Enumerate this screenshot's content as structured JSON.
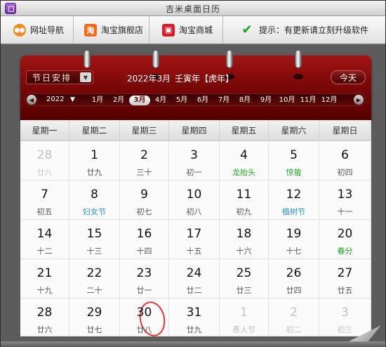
{
  "window": {
    "title": "吉米桌面日历"
  },
  "toolbar": {
    "nav_label": "网址导航",
    "flagship_label": "淘宝旗舰店",
    "mall_label": "淘宝商城",
    "tip_label": "提示：有更新请立刻升级软件"
  },
  "header": {
    "holiday_select": "节日安排",
    "current_month": "2022年3月",
    "ganzhi": "壬寅年【虎年】",
    "today_label": "今天"
  },
  "month_strip": {
    "year": "2022",
    "months": [
      "1月",
      "2月",
      "3月",
      "4月",
      "5月",
      "6月",
      "7月",
      "8月",
      "9月",
      "10月",
      "11月",
      "12月"
    ],
    "selected_month": "3月"
  },
  "weekdays": [
    "星期一",
    "星期二",
    "星期三",
    "星期四",
    "星期五",
    "星期六",
    "星期日"
  ],
  "days": [
    {
      "d": "28",
      "l": "廿八",
      "dim": true
    },
    {
      "d": "1",
      "l": "廿九"
    },
    {
      "d": "2",
      "l": "三十"
    },
    {
      "d": "3",
      "l": "初一"
    },
    {
      "d": "4",
      "l": "龙抬头",
      "c": "green"
    },
    {
      "d": "5",
      "l": "惊蛰",
      "c": "green"
    },
    {
      "d": "6",
      "l": "初四"
    },
    {
      "d": "7",
      "l": "初五"
    },
    {
      "d": "8",
      "l": "妇女节",
      "c": "blue"
    },
    {
      "d": "9",
      "l": "初七"
    },
    {
      "d": "10",
      "l": "初八"
    },
    {
      "d": "11",
      "l": "初九"
    },
    {
      "d": "12",
      "l": "植树节",
      "c": "blue"
    },
    {
      "d": "13",
      "l": "十一"
    },
    {
      "d": "14",
      "l": "十二"
    },
    {
      "d": "15",
      "l": "十三"
    },
    {
      "d": "16",
      "l": "十四"
    },
    {
      "d": "17",
      "l": "十五"
    },
    {
      "d": "18",
      "l": "十六"
    },
    {
      "d": "19",
      "l": "十七"
    },
    {
      "d": "20",
      "l": "春分",
      "c": "green"
    },
    {
      "d": "21",
      "l": "十九"
    },
    {
      "d": "22",
      "l": "二十"
    },
    {
      "d": "23",
      "l": "廿一"
    },
    {
      "d": "24",
      "l": "廿二"
    },
    {
      "d": "25",
      "l": "廿三"
    },
    {
      "d": "26",
      "l": "廿四"
    },
    {
      "d": "27",
      "l": "廿五"
    },
    {
      "d": "28",
      "l": "廿六"
    },
    {
      "d": "29",
      "l": "廿七"
    },
    {
      "d": "30",
      "l": "廿八",
      "today": true
    },
    {
      "d": "31",
      "l": "廿九"
    },
    {
      "d": "1",
      "l": "愚人节",
      "dim": true
    },
    {
      "d": "2",
      "l": "初二",
      "dim": true
    },
    {
      "d": "3",
      "l": "初三",
      "dim": true
    }
  ],
  "colors": {
    "header_red": "#7b0808",
    "festival_green": "#21a321",
    "festival_blue": "#2a93c9",
    "today_circle": "#e23a3a"
  }
}
